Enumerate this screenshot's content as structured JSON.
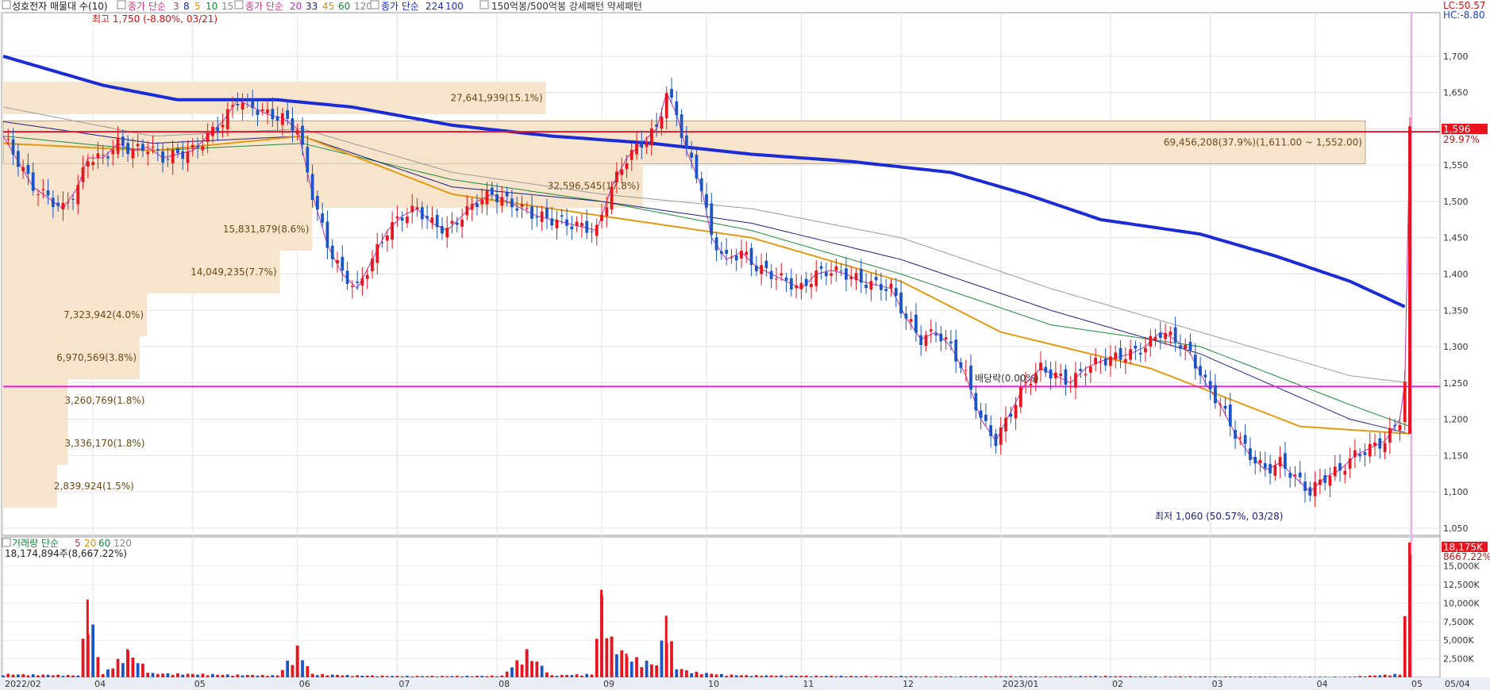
{
  "legend_top": {
    "stock": "성호전자 매물대 수(10)",
    "ma_price_label_a": "종가 단순",
    "ma_a": [
      "3",
      "8",
      "5",
      "10",
      "15"
    ],
    "ma_price_label_b": "종가 단순",
    "ma_b": [
      "20",
      "33",
      "45",
      "60",
      "120"
    ],
    "ma_price_label_c": "종가 단순",
    "ma_c": [
      "224",
      "100"
    ],
    "pattern": "150억봉/500억봉 강세패턴  약세패턴"
  },
  "legend_vol": {
    "label": "거래량 단순",
    "periods": [
      "5",
      "20",
      "60",
      "120"
    ],
    "last": "18,174,894주(8,667.22%)"
  },
  "corner": {
    "lc": "LC:50.57",
    "hc": "HC:-8.80"
  },
  "annotations": {
    "high": "최고 1,750 (-8.80%, 03/21)",
    "low": "최저 1,060 (50.57%, 03/28)",
    "dividend": "배당락(0.00%)",
    "current_price": "1,596",
    "current_pct": "29.97%",
    "vol_now": "18,175K",
    "vol_pct": "8667.22%"
  },
  "colors": {
    "up": "#e8141e",
    "down": "#1a54c8",
    "ma224": "#1b2bd6",
    "hline_red": "#d81a34",
    "hline_magenta": "#e81adc",
    "profile": "#f6e4cc"
  },
  "chart_data": {
    "type": "candlestick",
    "price_axis": {
      "min": 1040,
      "max": 1760,
      "ticks": [
        "1,700",
        "1,650",
        "1,600",
        "1,550",
        "1,500",
        "1,450",
        "1,400",
        "1,350",
        "1,300",
        "1,250",
        "1,200",
        "1,150",
        "1,100",
        "1,050"
      ],
      "tick_values": [
        1700,
        1650,
        1600,
        1550,
        1500,
        1450,
        1400,
        1350,
        1300,
        1250,
        1200,
        1150,
        1100,
        1050
      ]
    },
    "volume_axis": {
      "max": 18500,
      "ticks": [
        "15,000K",
        "12,500K",
        "10,000K",
        "7,500K",
        "5,000K",
        "2,500K"
      ],
      "tick_values": [
        15000,
        12500,
        10000,
        7500,
        5000,
        2500
      ]
    },
    "x_ticks": [
      "2022/02",
      "04",
      "05",
      "06",
      "07",
      "08",
      "09",
      "10",
      "11",
      "12",
      "2023/01",
      "02",
      "03",
      "04",
      "05",
      "05/04"
    ],
    "x_tick_index": [
      0,
      18,
      38,
      59,
      79,
      99,
      120,
      141,
      160,
      180,
      200,
      222,
      242,
      263,
      282
    ],
    "volume_profile": [
      {
        "label": "27,641,939(15.1%)",
        "lo": 1620,
        "hi": 1665,
        "pct": 15.1
      },
      {
        "label": "69,456,208(37.9%)(1,611.00 ~ 1,552.00)",
        "lo": 1552,
        "hi": 1611,
        "pct": 37.9
      },
      {
        "label": "32,596,545(17.8%)",
        "lo": 1491,
        "hi": 1552,
        "pct": 17.8
      },
      {
        "label": "15,831,879(8.6%)",
        "lo": 1432,
        "hi": 1491,
        "pct": 8.6
      },
      {
        "label": "14,049,235(7.7%)",
        "lo": 1373,
        "hi": 1432,
        "pct": 7.7
      },
      {
        "label": "7,323,942(4.0%)",
        "lo": 1314,
        "hi": 1373,
        "pct": 4.0
      },
      {
        "label": "6,970,569(3.8%)",
        "lo": 1255,
        "hi": 1314,
        "pct": 3.8
      },
      {
        "label": "3,260,769(1.8%)",
        "lo": 1196,
        "hi": 1255,
        "pct": 1.8
      },
      {
        "label": "3,336,170(1.8%)",
        "lo": 1137,
        "hi": 1196,
        "pct": 1.8
      },
      {
        "label": "2,839,924(1.5%)",
        "lo": 1078,
        "hi": 1137,
        "pct": 1.5
      }
    ],
    "hlines": {
      "red": 1596,
      "magenta": 1245
    },
    "ma224": [
      [
        0,
        1700
      ],
      [
        20,
        1660
      ],
      [
        35,
        1640
      ],
      [
        55,
        1640
      ],
      [
        70,
        1630
      ],
      [
        90,
        1605
      ],
      [
        110,
        1590
      ],
      [
        130,
        1580
      ],
      [
        150,
        1565
      ],
      [
        170,
        1555
      ],
      [
        190,
        1540
      ],
      [
        205,
        1510
      ],
      [
        220,
        1475
      ],
      [
        240,
        1455
      ],
      [
        255,
        1425
      ],
      [
        270,
        1390
      ],
      [
        282,
        1355
      ]
    ],
    "ma_blue": [
      [
        0,
        1610
      ],
      [
        30,
        1580
      ],
      [
        60,
        1590
      ],
      [
        90,
        1520
      ],
      [
        120,
        1500
      ],
      [
        150,
        1470
      ],
      [
        180,
        1420
      ],
      [
        210,
        1350
      ],
      [
        240,
        1290
      ],
      [
        270,
        1200
      ],
      [
        282,
        1180
      ]
    ],
    "ma_gray": [
      [
        0,
        1630
      ],
      [
        30,
        1590
      ],
      [
        60,
        1600
      ],
      [
        90,
        1540
      ],
      [
        120,
        1510
      ],
      [
        150,
        1490
      ],
      [
        180,
        1450
      ],
      [
        210,
        1380
      ],
      [
        240,
        1320
      ],
      [
        270,
        1260
      ],
      [
        282,
        1250
      ]
    ],
    "ma_green": [
      [
        0,
        1590
      ],
      [
        30,
        1570
      ],
      [
        60,
        1580
      ],
      [
        90,
        1530
      ],
      [
        120,
        1500
      ],
      [
        150,
        1460
      ],
      [
        180,
        1400
      ],
      [
        210,
        1330
      ],
      [
        240,
        1300
      ],
      [
        270,
        1220
      ],
      [
        282,
        1190
      ]
    ],
    "ma_orange": [
      [
        0,
        1580
      ],
      [
        30,
        1570
      ],
      [
        60,
        1590
      ],
      [
        90,
        1510
      ],
      [
        120,
        1480
      ],
      [
        150,
        1450
      ],
      [
        180,
        1390
      ],
      [
        200,
        1320
      ],
      [
        230,
        1270
      ],
      [
        260,
        1190
      ],
      [
        282,
        1180
      ]
    ],
    "close": [
      [
        0,
        1590
      ],
      [
        3,
        1555
      ],
      [
        6,
        1520
      ],
      [
        9,
        1505
      ],
      [
        12,
        1490
      ],
      [
        15,
        1520
      ],
      [
        17,
        1560
      ],
      [
        20,
        1560
      ],
      [
        23,
        1580
      ],
      [
        26,
        1570
      ],
      [
        29,
        1575
      ],
      [
        32,
        1560
      ],
      [
        35,
        1565
      ],
      [
        38,
        1570
      ],
      [
        41,
        1590
      ],
      [
        44,
        1610
      ],
      [
        47,
        1640
      ],
      [
        50,
        1630
      ],
      [
        53,
        1620
      ],
      [
        56,
        1615
      ],
      [
        59,
        1600
      ],
      [
        62,
        1510
      ],
      [
        65,
        1440
      ],
      [
        68,
        1400
      ],
      [
        71,
        1380
      ],
      [
        74,
        1420
      ],
      [
        77,
        1460
      ],
      [
        80,
        1480
      ],
      [
        83,
        1490
      ],
      [
        86,
        1470
      ],
      [
        89,
        1460
      ],
      [
        92,
        1480
      ],
      [
        95,
        1500
      ],
      [
        98,
        1510
      ],
      [
        101,
        1500
      ],
      [
        104,
        1490
      ],
      [
        107,
        1480
      ],
      [
        110,
        1475
      ],
      [
        113,
        1470
      ],
      [
        116,
        1465
      ],
      [
        119,
        1460
      ],
      [
        122,
        1520
      ],
      [
        125,
        1560
      ],
      [
        128,
        1580
      ],
      [
        131,
        1600
      ],
      [
        133,
        1650
      ],
      [
        135,
        1620
      ],
      [
        137,
        1570
      ],
      [
        140,
        1520
      ],
      [
        142,
        1450
      ],
      [
        145,
        1420
      ],
      [
        148,
        1430
      ],
      [
        151,
        1410
      ],
      [
        154,
        1400
      ],
      [
        157,
        1390
      ],
      [
        160,
        1380
      ],
      [
        163,
        1400
      ],
      [
        166,
        1405
      ],
      [
        169,
        1400
      ],
      [
        172,
        1390
      ],
      [
        175,
        1385
      ],
      [
        178,
        1380
      ],
      [
        181,
        1340
      ],
      [
        184,
        1310
      ],
      [
        187,
        1320
      ],
      [
        190,
        1300
      ],
      [
        193,
        1260
      ],
      [
        196,
        1200
      ],
      [
        199,
        1170
      ],
      [
        202,
        1210
      ],
      [
        205,
        1250
      ],
      [
        208,
        1270
      ],
      [
        211,
        1260
      ],
      [
        214,
        1250
      ],
      [
        217,
        1270
      ],
      [
        220,
        1280
      ],
      [
        223,
        1285
      ],
      [
        226,
        1290
      ],
      [
        229,
        1300
      ],
      [
        232,
        1320
      ],
      [
        235,
        1310
      ],
      [
        238,
        1290
      ],
      [
        241,
        1250
      ],
      [
        244,
        1220
      ],
      [
        247,
        1180
      ],
      [
        250,
        1150
      ],
      [
        253,
        1130
      ],
      [
        256,
        1140
      ],
      [
        259,
        1120
      ],
      [
        262,
        1100
      ],
      [
        265,
        1120
      ],
      [
        268,
        1130
      ],
      [
        271,
        1150
      ],
      [
        274,
        1160
      ],
      [
        277,
        1170
      ],
      [
        280,
        1200
      ],
      [
        281,
        1250
      ],
      [
        282,
        1596
      ]
    ],
    "volume": [
      [
        0,
        500
      ],
      [
        5,
        420
      ],
      [
        10,
        380
      ],
      [
        15,
        300
      ],
      [
        17,
        10500
      ],
      [
        20,
        500
      ],
      [
        25,
        3800
      ],
      [
        30,
        600
      ],
      [
        40,
        500
      ],
      [
        45,
        400
      ],
      [
        55,
        300
      ],
      [
        59,
        4300
      ],
      [
        62,
        500
      ],
      [
        70,
        300
      ],
      [
        80,
        200
      ],
      [
        90,
        200
      ],
      [
        100,
        250
      ],
      [
        105,
        3800
      ],
      [
        110,
        300
      ],
      [
        118,
        500
      ],
      [
        120,
        11800
      ],
      [
        122,
        5500
      ],
      [
        125,
        3200
      ],
      [
        128,
        2500
      ],
      [
        131,
        2000
      ],
      [
        133,
        8300
      ],
      [
        135,
        1500
      ],
      [
        138,
        800
      ],
      [
        145,
        400
      ],
      [
        150,
        300
      ],
      [
        160,
        250
      ],
      [
        170,
        200
      ],
      [
        180,
        180
      ],
      [
        190,
        150
      ],
      [
        200,
        180
      ],
      [
        210,
        150
      ],
      [
        220,
        200
      ],
      [
        230,
        150
      ],
      [
        240,
        150
      ],
      [
        250,
        120
      ],
      [
        260,
        100
      ],
      [
        270,
        100
      ],
      [
        280,
        500
      ],
      [
        282,
        18175
      ]
    ]
  }
}
